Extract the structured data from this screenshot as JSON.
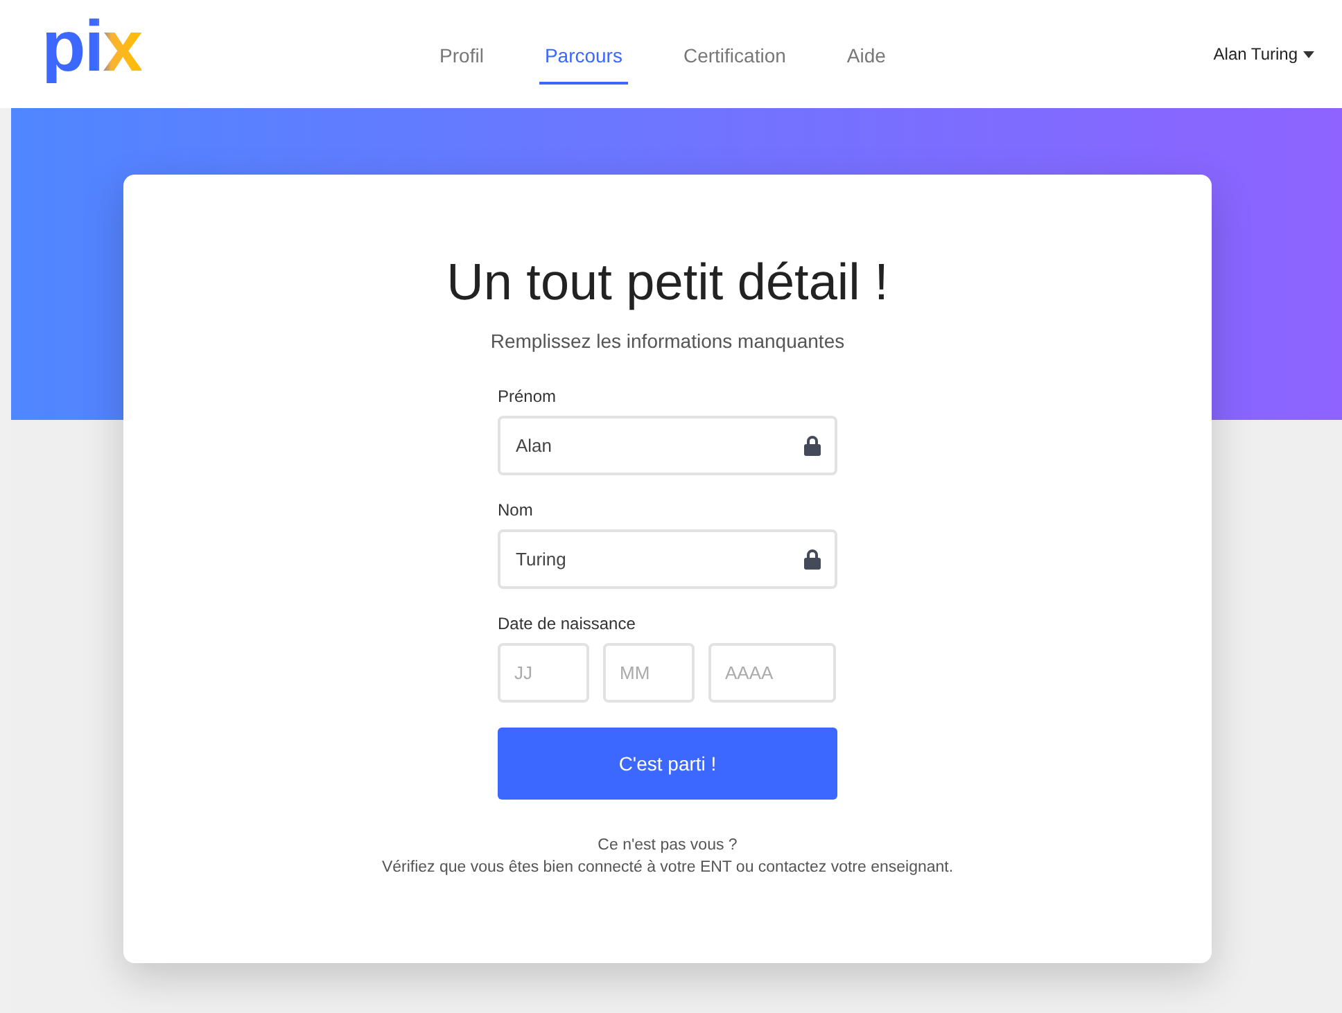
{
  "header": {
    "logo": "pix",
    "nav": [
      {
        "label": "Profil",
        "selected": false
      },
      {
        "label": "Parcours",
        "selected": true
      },
      {
        "label": "Certification",
        "selected": false
      },
      {
        "label": "Aide",
        "selected": false
      }
    ],
    "user_menu": "Alan Turing"
  },
  "card": {
    "title": "Un tout petit détail !",
    "subtitle": "Remplissez les informations manquantes",
    "fields": [
      {
        "label": "Prénom",
        "value": "Alan",
        "locked": true
      },
      {
        "label": "Nom",
        "value": "Turing",
        "locked": true
      }
    ],
    "birthdate": {
      "label": "Date de naissance",
      "placeholders": [
        "JJ",
        "MM",
        "AAAA"
      ]
    },
    "submit": "C'est parti !",
    "help": [
      "Ce n'est pas vous ?",
      "Vérifiez que vous êtes bien connecté à votre ENT ou contactez votre enseignant."
    ]
  }
}
